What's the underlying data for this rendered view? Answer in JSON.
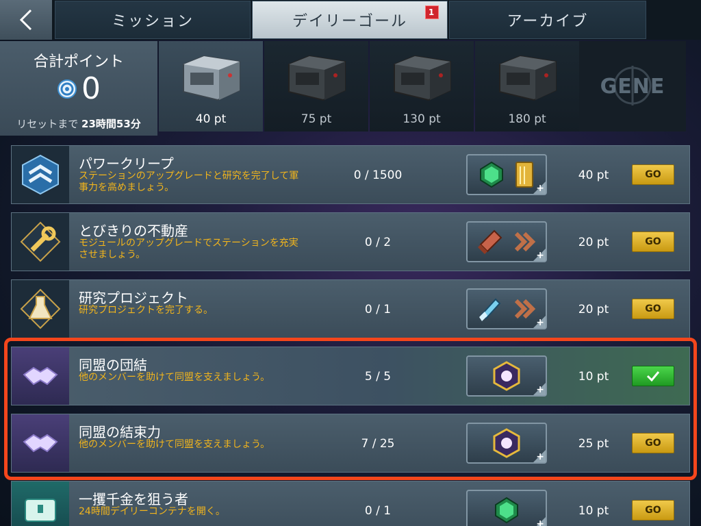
{
  "tabs": [
    {
      "label": "ミッション"
    },
    {
      "label": "デイリーゴール",
      "badge": "1"
    },
    {
      "label": "アーカイブ"
    }
  ],
  "points": {
    "title": "合計ポイント",
    "value": "0",
    "reset_prefix": "リセットまで",
    "reset_time": "23時間53分"
  },
  "chests": [
    {
      "label": "40 pt"
    },
    {
      "label": "75 pt"
    },
    {
      "label": "130 pt"
    },
    {
      "label": "180 pt"
    }
  ],
  "gene_label": "GENE",
  "missions": [
    {
      "title": "パワークリープ",
      "desc": "ステーションのアップグレードと研究を完了して軍事力を高めましょう。",
      "progress": "0 / 1500",
      "points": "40 pt",
      "button": "GO"
    },
    {
      "title": "とびきりの不動産",
      "desc": "モジュールのアップグレードでステーションを充実させましょう。",
      "progress": "0 / 2",
      "points": "20 pt",
      "button": "GO"
    },
    {
      "title": "研究プロジェクト",
      "desc": "研究プロジェクトを完了する。",
      "progress": "0 / 1",
      "points": "20 pt",
      "button": "GO"
    },
    {
      "title": "同盟の団結",
      "desc": "他のメンバーを助けて同盟を支えましょう。",
      "progress": "5 / 5",
      "points": "10 pt",
      "button": "",
      "done": true
    },
    {
      "title": "同盟の結束力",
      "desc": "他のメンバーを助けて同盟を支えましょう。",
      "progress": "7 / 25",
      "points": "25 pt",
      "button": "GO"
    },
    {
      "title": "一攫千金を狙う者",
      "desc": "24時間デイリーコンテナを開く。",
      "progress": "0 / 1",
      "points": "10 pt",
      "button": "GO"
    }
  ]
}
